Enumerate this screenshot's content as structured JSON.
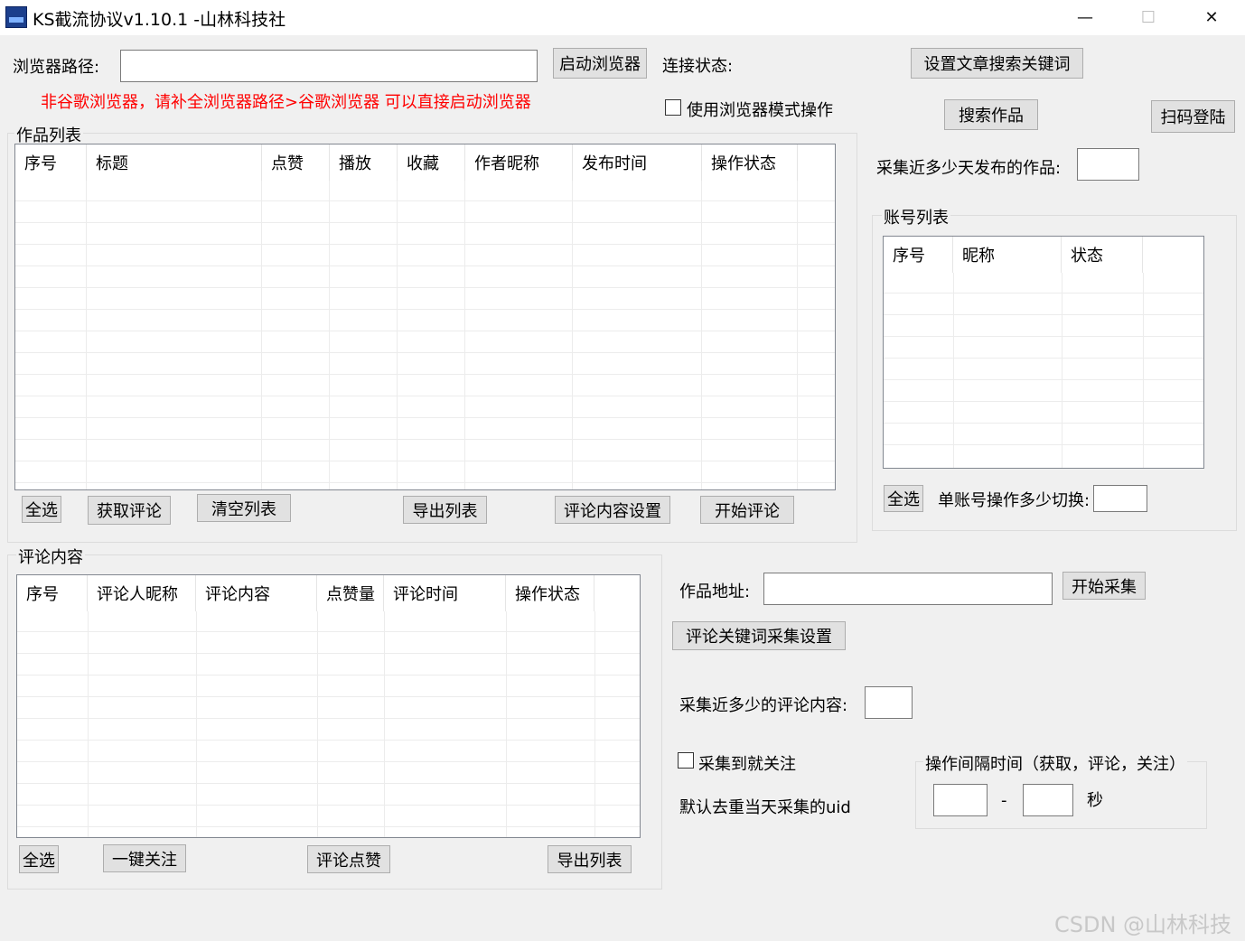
{
  "window": {
    "title": "KS截流协议v1.10.1 -山林科技社",
    "minimize_icon": "—",
    "maximize_icon": "☐",
    "close_icon": "✕"
  },
  "top": {
    "browser_path_label": "浏览器路径:",
    "browser_path_value": "",
    "launch_browser_button": "启动浏览器",
    "connection_status_label": "连接状态:",
    "set_keywords_button": "设置文章搜索关键词",
    "hint_text": "非谷歌浏览器，请补全浏览器路径>谷歌浏览器 可以直接启动浏览器",
    "browser_mode_checkbox_label": "使用浏览器模式操作",
    "search_works_button": "搜索作品",
    "qr_login_button": "扫码登陆"
  },
  "works": {
    "group_title": "作品列表",
    "columns": [
      "序号",
      "标题",
      "点赞",
      "播放",
      "收藏",
      "作者昵称",
      "发布时间",
      "操作状态"
    ],
    "buttons": {
      "select_all": "全选",
      "fetch_comments": "获取评论",
      "clear_list": "清空列表",
      "export_list": "导出列表",
      "comment_settings": "评论内容设置",
      "start_comment": "开始评论"
    }
  },
  "right": {
    "recent_days_label": "采集近多少天发布的作品:",
    "recent_days_value": "",
    "accounts_group_title": "账号列表",
    "account_columns": [
      "序号",
      "昵称",
      "状态"
    ],
    "select_all": "全选",
    "switch_label": "单账号操作多少切换:",
    "switch_value": ""
  },
  "comments": {
    "group_title": "评论内容",
    "columns": [
      "序号",
      "评论人昵称",
      "评论内容",
      "点赞量",
      "评论时间",
      "操作状态"
    ],
    "buttons": {
      "select_all": "全选",
      "follow_all": "一键关注",
      "like_comment": "评论点赞",
      "export_list": "导出列表"
    }
  },
  "collect": {
    "work_url_label": "作品地址:",
    "work_url_value": "",
    "start_collect_button": "开始采集",
    "keyword_settings_button": "评论关键词采集设置",
    "recent_comments_label": "采集近多少的评论内容:",
    "recent_comments_value": "",
    "follow_checkbox_label": "采集到就关注",
    "dedup_text": "默认去重当天采集的uid",
    "interval_group_title": "操作间隔时间（获取，评论，关注）",
    "interval_from": "",
    "interval_dash": "-",
    "interval_unit": "秒"
  },
  "watermark": "CSDN @山林科技"
}
